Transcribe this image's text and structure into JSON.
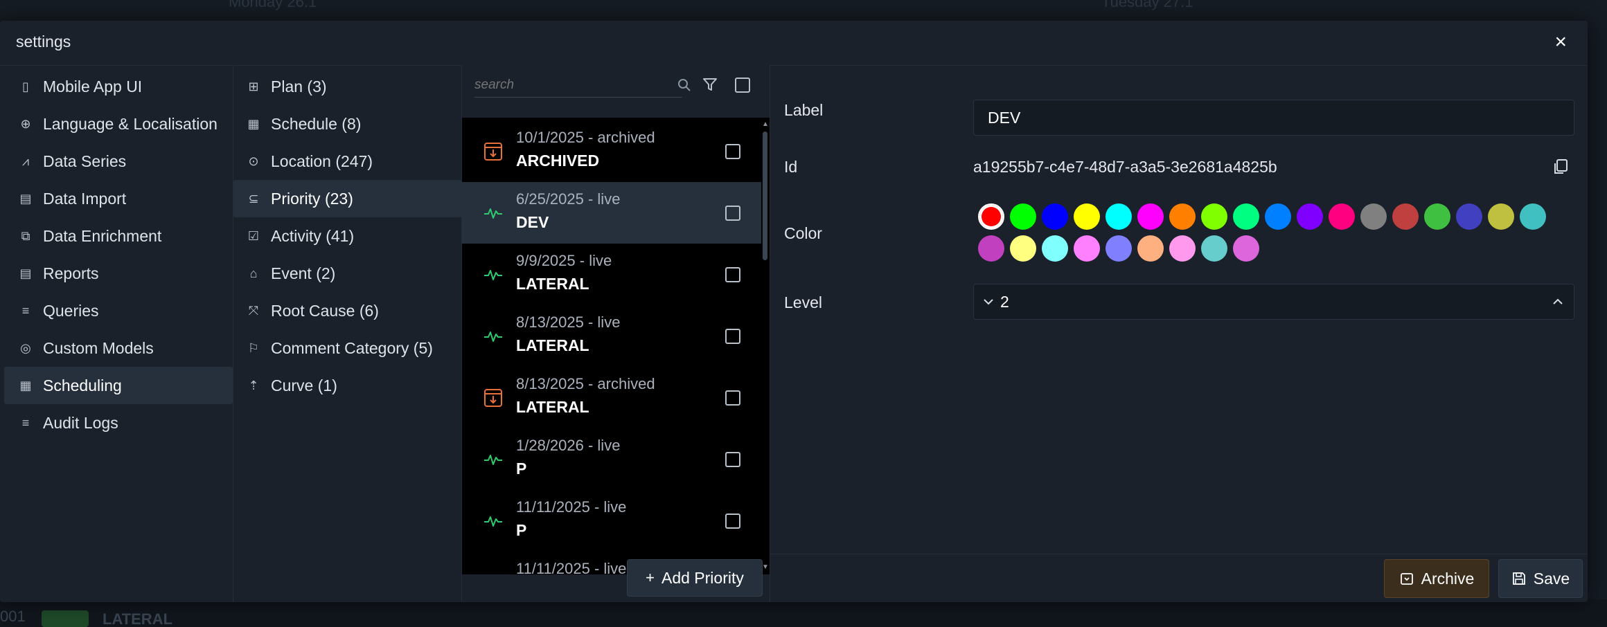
{
  "background": {
    "day_left": "Monday 26.1",
    "day_right": "Tuesday 27.1",
    "row_code": "001",
    "row_label": "LATERAL"
  },
  "dialog": {
    "title": "settings",
    "close_label": "×"
  },
  "main_nav": [
    {
      "label": "Mobile App UI",
      "icon": "phone-icon",
      "glyph": "▯"
    },
    {
      "label": "Language & Localisation",
      "icon": "globe-icon",
      "glyph": "⊕"
    },
    {
      "label": "Data Series",
      "icon": "line-chart-icon",
      "glyph": "⩘"
    },
    {
      "label": "Data Import",
      "icon": "file-import-icon",
      "glyph": "▤"
    },
    {
      "label": "Data Enrichment",
      "icon": "enrich-icon",
      "glyph": "⧉"
    },
    {
      "label": "Reports",
      "icon": "report-icon",
      "glyph": "▤"
    },
    {
      "label": "Queries",
      "icon": "query-icon",
      "glyph": "≡"
    },
    {
      "label": "Custom Models",
      "icon": "model-icon",
      "glyph": "◎"
    },
    {
      "label": "Scheduling",
      "icon": "calendar-icon",
      "glyph": "▦",
      "active": true
    },
    {
      "label": "Audit Logs",
      "icon": "audit-icon",
      "glyph": "≡"
    }
  ],
  "sub_nav": [
    {
      "label": "Plan (3)",
      "icon": "plan-icon",
      "glyph": "⊞"
    },
    {
      "label": "Schedule (8)",
      "icon": "calendar-icon",
      "glyph": "▦"
    },
    {
      "label": "Location (247)",
      "icon": "location-pin-icon",
      "glyph": "⊙"
    },
    {
      "label": "Priority (23)",
      "icon": "priority-icon",
      "glyph": "⊆",
      "active": true
    },
    {
      "label": "Activity (41)",
      "icon": "activity-icon",
      "glyph": "☑"
    },
    {
      "label": "Event (2)",
      "icon": "event-icon",
      "glyph": "⌂"
    },
    {
      "label": "Root Cause (6)",
      "icon": "root-cause-icon",
      "glyph": "⤧"
    },
    {
      "label": "Comment Category (5)",
      "icon": "comment-icon",
      "glyph": "⚐"
    },
    {
      "label": "Curve (1)",
      "icon": "curve-icon",
      "glyph": "⇡"
    }
  ],
  "search": {
    "placeholder": "search"
  },
  "priority_list": [
    {
      "date": "10/1/2025 - archived",
      "label": "ARCHIVED",
      "status": "archived"
    },
    {
      "date": "6/25/2025 - live",
      "label": "DEV",
      "status": "live",
      "selected": true
    },
    {
      "date": "9/9/2025 - live",
      "label": "LATERAL",
      "status": "live"
    },
    {
      "date": "8/13/2025 - live",
      "label": "LATERAL",
      "status": "live"
    },
    {
      "date": "8/13/2025 - archived",
      "label": "LATERAL",
      "status": "archived"
    },
    {
      "date": "1/28/2026 - live",
      "label": "P",
      "status": "live"
    },
    {
      "date": "11/11/2025 - live",
      "label": "P",
      "status": "live"
    },
    {
      "date": "11/11/2025 - live",
      "label": "",
      "status": "live"
    }
  ],
  "add_button": {
    "label": "Add Priority",
    "plus": "+"
  },
  "form": {
    "label_label": "Label",
    "label_value": "DEV",
    "id_label": "Id",
    "id_value": "a19255b7-c4e7-48d7-a3a5-3e2681a4825b",
    "color_label": "Color",
    "level_label": "Level",
    "level_value": "2",
    "selected_color": "#ff0000",
    "colors": [
      "#ff0000",
      "#00ff00",
      "#0000ff",
      "#ffff00",
      "#00ffff",
      "#ff00ff",
      "#ff8000",
      "#80ff00",
      "#00ff80",
      "#0080ff",
      "#8000ff",
      "#ff0080",
      "#808080",
      "#c04040",
      "#40c040",
      "#4040c0",
      "#c0c040",
      "#40c0c0",
      "#c040c0",
      "#ffff80",
      "#80ffff",
      "#ff80ff",
      "#8080ff",
      "#ffb080",
      "#ff99ee",
      "#66cccc",
      "#dd66dd"
    ]
  },
  "footer": {
    "archive_label": "Archive",
    "save_label": "Save"
  }
}
